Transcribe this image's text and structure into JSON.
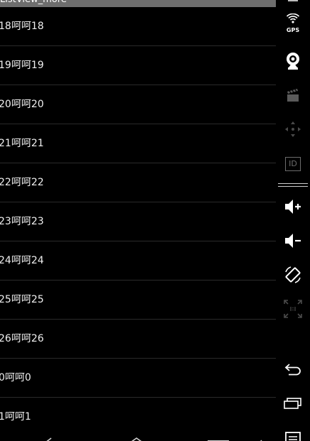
{
  "app": {
    "title": "ListView_more"
  },
  "list": {
    "items": [
      {
        "label": "18呵呵18"
      },
      {
        "label": "19呵呵19"
      },
      {
        "label": "20呵呵20"
      },
      {
        "label": "21呵呵21"
      },
      {
        "label": "22呵呵22"
      },
      {
        "label": "23呵呵23"
      },
      {
        "label": "24呵呵24"
      },
      {
        "label": "25呵呵25"
      },
      {
        "label": "26呵呵26"
      },
      {
        "label": "0呵呵0"
      },
      {
        "label": "1呵呵1"
      }
    ]
  },
  "side_panel": {
    "gps_label": "GPS",
    "id_label": "ID",
    "buttons": [
      {
        "icon": "gps-icon"
      },
      {
        "icon": "camera-icon"
      },
      {
        "icon": "video-clapper-icon"
      },
      {
        "icon": "dpad-icon"
      },
      {
        "icon": "id-icon"
      },
      {
        "icon": "volume-up-icon"
      },
      {
        "icon": "volume-down-icon"
      },
      {
        "icon": "rotate-icon"
      },
      {
        "icon": "scale-icon"
      },
      {
        "icon": "back-icon"
      },
      {
        "icon": "recent-apps-icon"
      },
      {
        "icon": "menu-icon"
      }
    ]
  },
  "colors": {
    "background": "#000000",
    "titlebar": "#6e6e6e",
    "list_text": "#f0f0f0",
    "divider": "#2a2a2a",
    "panel_icon_active": "#ffffff",
    "panel_icon_disabled": "#6d6d6d"
  }
}
